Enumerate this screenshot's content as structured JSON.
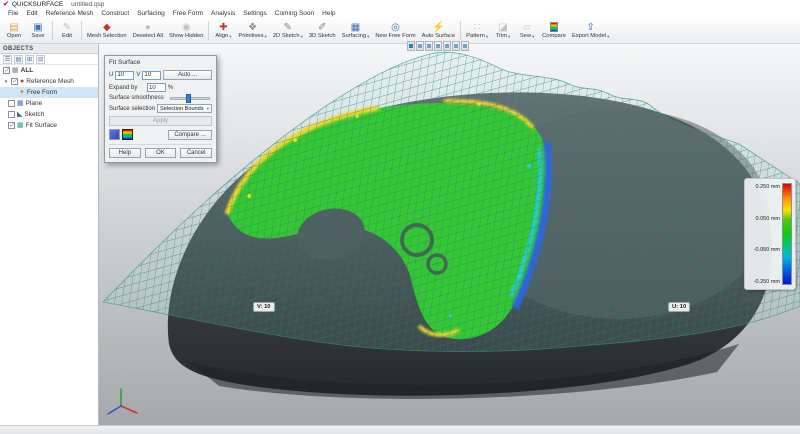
{
  "window": {
    "title_app": "QUICKSURFACE",
    "title_doc": "untitled.qsp",
    "logo_glyph": "✔"
  },
  "ui": {
    "check": "✓",
    "dropdown_arrow": "▾",
    "expander": "▾"
  },
  "menu": {
    "items": [
      "File",
      "Edit",
      "Reference Mesh",
      "Construct",
      "Surfacing",
      "Free Form",
      "Analysis",
      "Settings",
      "Coming Soon",
      "Help"
    ]
  },
  "toolbar": {
    "items": [
      {
        "label": "Open",
        "icon": "open-icon",
        "glyph": "▤"
      },
      {
        "label": "Save",
        "icon": "save-icon",
        "glyph": "▣"
      },
      {
        "label": "Edit",
        "icon": "edit-icon",
        "glyph": "✎"
      },
      {
        "label": "Mesh Selection",
        "icon": "mesh-selection-icon",
        "glyph": "◆"
      },
      {
        "label": "Deselect All",
        "icon": "deselect-all-icon",
        "glyph": "●"
      },
      {
        "label": "Show Hidden",
        "icon": "show-hidden-icon",
        "glyph": "◉"
      },
      {
        "label": "Align",
        "icon": "align-icon",
        "glyph": "✚"
      },
      {
        "label": "Primitives",
        "icon": "primitives-icon",
        "glyph": "❖"
      },
      {
        "label": "2D Sketch",
        "icon": "sketch-2d-icon",
        "glyph": "✎"
      },
      {
        "label": "3D Sketch",
        "icon": "sketch-3d-icon",
        "glyph": "✐"
      },
      {
        "label": "Surfacing",
        "icon": "surfacing-icon",
        "glyph": "▦"
      },
      {
        "label": "New Free Form",
        "icon": "new-free-form-icon",
        "glyph": "◎"
      },
      {
        "label": "Auto Surface",
        "icon": "auto-surface-icon",
        "glyph": "⚡"
      },
      {
        "label": "Pattern",
        "icon": "pattern-icon",
        "glyph": "∷"
      },
      {
        "label": "Trim",
        "icon": "trim-icon",
        "glyph": "◪"
      },
      {
        "label": "Sew",
        "icon": "sew-icon",
        "glyph": "▱"
      },
      {
        "label": "Compare",
        "icon": "compare-icon",
        "glyph": ""
      },
      {
        "label": "Export Model",
        "icon": "export-model-icon",
        "glyph": "⇪"
      }
    ]
  },
  "objects_panel": {
    "title": "OBJECTS",
    "all_label": "ALL",
    "all_glyph": "▦",
    "tools": [
      {
        "icon": "list-view-icon",
        "glyph": "☰"
      },
      {
        "icon": "expand-all-icon",
        "glyph": "▤"
      },
      {
        "icon": "collapse-all-icon",
        "glyph": "⊞"
      },
      {
        "icon": "filter-icon",
        "glyph": "⊟"
      }
    ],
    "items": [
      {
        "label": "Reference Mesh",
        "glyph": "●",
        "checked": true,
        "children": [
          {
            "label": "Free Form",
            "glyph": "✦",
            "selected": true
          }
        ]
      },
      {
        "label": "Plane",
        "glyph": "▦",
        "checked": false
      },
      {
        "label": "Sketch",
        "glyph": "◣",
        "checked": false
      },
      {
        "label": "Fit Surface",
        "glyph": "▦",
        "checked": true
      }
    ]
  },
  "dialog": {
    "title": "Fit Surface",
    "u_label": "U",
    "u_value": "10",
    "v_label": "V",
    "v_value": "10",
    "auto_button": "Auto ...",
    "expand_label": "Expand by",
    "expand_value": "10",
    "expand_unit": "%",
    "smoothness_label": "Surface smoothness",
    "selection_label": "Surface selection",
    "selection_value": "Selection Bounds",
    "apply_button": "Apply",
    "compare_button": "Compare ...",
    "help_button": "Help",
    "ok_button": "OK",
    "cancel_button": "Cancel"
  },
  "viewport": {
    "v_badge": "V: 10",
    "u_badge": "U: 10",
    "legend": {
      "labels": [
        "0.250 mm",
        "0.050 mm",
        "-0.050 mm",
        "-0.250 mm"
      ],
      "colors": {
        "max": "#e00000",
        "mid_high": "#ffe000",
        "zero": "#10c810",
        "mid_low": "#00b4e0",
        "min": "#0018d0"
      }
    }
  }
}
